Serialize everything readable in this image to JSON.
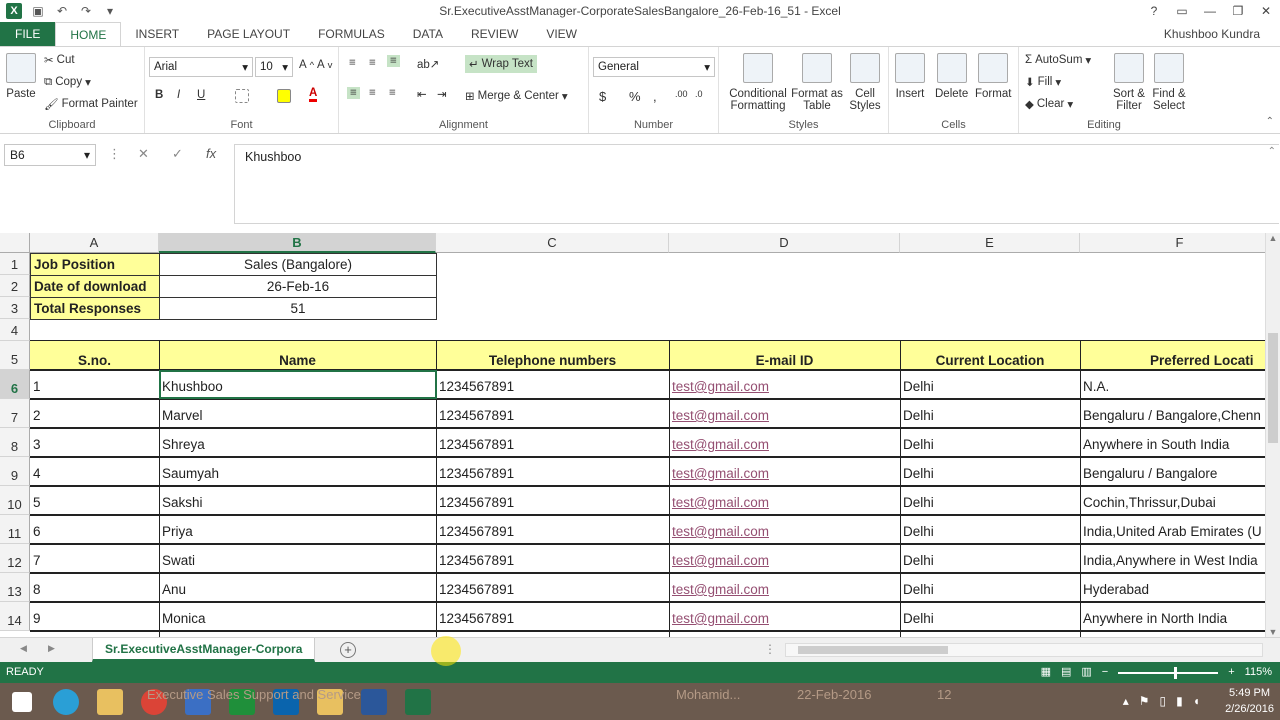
{
  "window": {
    "title": "Sr.ExecutiveAsstManager-CorporateSalesBangalore_26-Feb-16_51 - Excel",
    "user": "Khushboo Kundra",
    "controls": [
      "?",
      "▭",
      "—",
      "❐",
      "✕"
    ]
  },
  "tabs": [
    "FILE",
    "HOME",
    "INSERT",
    "PAGE LAYOUT",
    "FORMULAS",
    "DATA",
    "REVIEW",
    "VIEW"
  ],
  "active_tab": "HOME",
  "ribbon": {
    "clipboard": {
      "label": "Clipboard",
      "paste": "Paste",
      "cut": "Cut",
      "copy": "Copy",
      "format_painter": "Format Painter"
    },
    "font": {
      "label": "Font",
      "font_name": "Arial",
      "font_size": "10",
      "bold": "B",
      "italic": "I",
      "underline": "U"
    },
    "alignment": {
      "label": "Alignment",
      "wrap_text": "Wrap Text",
      "merge_center": "Merge & Center"
    },
    "number": {
      "label": "Number",
      "format": "General",
      "currency": "$",
      "percent": "%",
      "comma": ","
    },
    "styles": {
      "label": "Styles",
      "conditional": "Conditional Formatting",
      "format_table": "Format as Table",
      "cell_styles": "Cell Styles"
    },
    "cells": {
      "label": "Cells",
      "insert": "Insert",
      "delete": "Delete",
      "format": "Format"
    },
    "editing": {
      "label": "Editing",
      "autosum": "AutoSum",
      "fill": "Fill",
      "clear": "Clear",
      "sort_filter": "Sort & Filter",
      "find_select": "Find & Select"
    }
  },
  "formula_bar": {
    "name_box": "B6",
    "value": "Khushboo"
  },
  "columns": [
    "A",
    "B",
    "C",
    "D",
    "E",
    "F"
  ],
  "selected_column": "B",
  "rows": [
    "1",
    "2",
    "3",
    "4",
    "5",
    "6",
    "7",
    "8",
    "9",
    "10",
    "11",
    "12",
    "13",
    "14"
  ],
  "selected_row": "6",
  "meta_table": [
    {
      "label": "Job Position",
      "value": "Sales (Bangalore)"
    },
    {
      "label": "Date of download",
      "value": "26-Feb-16"
    },
    {
      "label": "Total Responses",
      "value": "51"
    }
  ],
  "headers": [
    "S.no.",
    "Name",
    "Telephone numbers",
    "E-mail ID",
    "Current Location",
    "Preferred Locati"
  ],
  "records": [
    {
      "sno": "1",
      "name": "Khushboo",
      "phone": "1234567891",
      "email": "test@gmail.com",
      "location": "Delhi",
      "preferred": "N.A."
    },
    {
      "sno": "2",
      "name": "Marvel",
      "phone": "1234567891",
      "email": "test@gmail.com",
      "location": "Delhi",
      "preferred": "Bengaluru / Bangalore,Chenn"
    },
    {
      "sno": "3",
      "name": "Shreya",
      "phone": "1234567891",
      "email": "test@gmail.com",
      "location": "Delhi",
      "preferred": "Anywhere in South India"
    },
    {
      "sno": "4",
      "name": "Saumyah",
      "phone": "1234567891",
      "email": "test@gmail.com",
      "location": "Delhi",
      "preferred": "Bengaluru / Bangalore"
    },
    {
      "sno": "5",
      "name": "Sakshi",
      "phone": "1234567891",
      "email": "test@gmail.com",
      "location": "Delhi",
      "preferred": "Cochin,Thrissur,Dubai"
    },
    {
      "sno": "6",
      "name": "Priya",
      "phone": "1234567891",
      "email": "test@gmail.com",
      "location": "Delhi",
      "preferred": "India,United Arab Emirates (U"
    },
    {
      "sno": "7",
      "name": "Swati",
      "phone": "1234567891",
      "email": "test@gmail.com",
      "location": "Delhi",
      "preferred": "India,Anywhere in West India"
    },
    {
      "sno": "8",
      "name": "Anu",
      "phone": "1234567891",
      "email": "test@gmail.com",
      "location": "Delhi",
      "preferred": "Hyderabad"
    },
    {
      "sno": "9",
      "name": "Monica",
      "phone": "1234567891",
      "email": "test@gmail.com",
      "location": "Delhi",
      "preferred": "Anywhere in North India"
    }
  ],
  "sheet_tab": "Sr.ExecutiveAsstManager-Corpora",
  "status": {
    "ready": "READY",
    "zoom": "115%"
  },
  "taskbar": {
    "ghost_text": [
      "Executive Sales Support and Service",
      "Mohamid...",
      "22-Feb-2016",
      "12"
    ],
    "time": "5:49 PM",
    "date": "2/26/2016"
  }
}
